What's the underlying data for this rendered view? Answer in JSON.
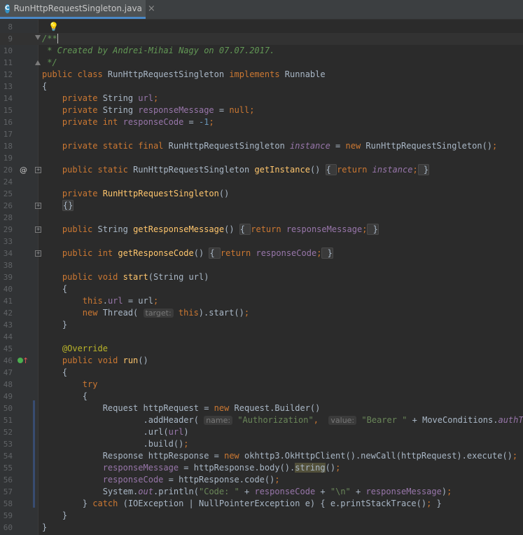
{
  "tab": {
    "icon_letter": "C",
    "title": "RunHttpRequestSingleton.java",
    "close": "×"
  },
  "lines": [
    {
      "num": "8",
      "parts": []
    },
    {
      "num": "9",
      "parts": [
        [
          "cm",
          "/**"
        ]
      ]
    },
    {
      "num": "10",
      "parts": [
        [
          "cm",
          " * Created by Andrei-Mihai Nagy on 07.07.2017."
        ]
      ]
    },
    {
      "num": "11",
      "parts": [
        [
          "cm",
          " */"
        ]
      ]
    },
    {
      "num": "12",
      "parts": [
        [
          "kw",
          "public class "
        ],
        [
          "",
          "RunHttpRequestSingleton "
        ],
        [
          "kw",
          "implements "
        ],
        [
          "",
          "Runnable"
        ]
      ]
    },
    {
      "num": "13",
      "parts": [
        [
          "",
          "{"
        ]
      ]
    },
    {
      "num": "14",
      "parts": [
        [
          "",
          "    "
        ],
        [
          "kw",
          "private "
        ],
        [
          "",
          "String "
        ],
        [
          "fld",
          "url"
        ],
        [
          "kw",
          ";"
        ]
      ]
    },
    {
      "num": "15",
      "parts": [
        [
          "",
          "    "
        ],
        [
          "kw",
          "private "
        ],
        [
          "",
          "String "
        ],
        [
          "fld",
          "responseMessage"
        ],
        [
          "",
          " = "
        ],
        [
          "kw",
          "null;"
        ]
      ]
    },
    {
      "num": "16",
      "parts": [
        [
          "",
          "    "
        ],
        [
          "kw",
          "private int "
        ],
        [
          "fld",
          "responseCode"
        ],
        [
          "",
          " = "
        ],
        [
          "num",
          "-1"
        ],
        [
          "kw",
          ";"
        ]
      ]
    },
    {
      "num": "17",
      "parts": []
    },
    {
      "num": "18",
      "parts": [
        [
          "",
          "    "
        ],
        [
          "kw",
          "private static final "
        ],
        [
          "",
          "RunHttpRequestSingleton "
        ],
        [
          "sfld",
          "instance"
        ],
        [
          "",
          " = "
        ],
        [
          "kw",
          "new "
        ],
        [
          "",
          "RunHttpRequestSingleton()"
        ],
        [
          "kw",
          ";"
        ]
      ]
    },
    {
      "num": "19",
      "parts": []
    },
    {
      "num": "20",
      "parts": [
        [
          "",
          "    "
        ],
        [
          "kw",
          "public static "
        ],
        [
          "",
          "RunHttpRequestSingleton "
        ],
        [
          "mth",
          "getInstance"
        ],
        [
          "",
          "() "
        ],
        [
          "folded",
          "{ "
        ],
        [
          "kw",
          "return "
        ],
        [
          "sfld",
          "instance"
        ],
        [
          "kw",
          ";"
        ],
        [
          "folded",
          " }"
        ]
      ]
    },
    {
      "num": "24",
      "parts": []
    },
    {
      "num": "25",
      "parts": [
        [
          "",
          "    "
        ],
        [
          "kw",
          "private "
        ],
        [
          "mth",
          "RunHttpRequestSingleton"
        ],
        [
          "",
          "()"
        ]
      ]
    },
    {
      "num": "26",
      "parts": [
        [
          "",
          "    "
        ],
        [
          "folded",
          "{}"
        ]
      ]
    },
    {
      "num": "28",
      "parts": []
    },
    {
      "num": "29",
      "parts": [
        [
          "",
          "    "
        ],
        [
          "kw",
          "public "
        ],
        [
          "",
          "String "
        ],
        [
          "mth",
          "getResponseMessage"
        ],
        [
          "",
          "() "
        ],
        [
          "folded",
          "{ "
        ],
        [
          "kw",
          "return "
        ],
        [
          "fld",
          "responseMessage"
        ],
        [
          "kw",
          ";"
        ],
        [
          "folded",
          " }"
        ]
      ]
    },
    {
      "num": "33",
      "parts": []
    },
    {
      "num": "34",
      "parts": [
        [
          "",
          "    "
        ],
        [
          "kw",
          "public int "
        ],
        [
          "mth",
          "getResponseCode"
        ],
        [
          "",
          "() "
        ],
        [
          "folded",
          "{ "
        ],
        [
          "kw",
          "return "
        ],
        [
          "fld",
          "responseCode"
        ],
        [
          "kw",
          ";"
        ],
        [
          "folded",
          " }"
        ]
      ]
    },
    {
      "num": "38",
      "parts": []
    },
    {
      "num": "39",
      "parts": [
        [
          "",
          "    "
        ],
        [
          "kw",
          "public void "
        ],
        [
          "mth",
          "start"
        ],
        [
          "",
          "(String url)"
        ]
      ]
    },
    {
      "num": "40",
      "parts": [
        [
          "",
          "    {"
        ]
      ]
    },
    {
      "num": "41",
      "parts": [
        [
          "",
          "        "
        ],
        [
          "kw",
          "this"
        ],
        [
          "",
          "."
        ],
        [
          "fld",
          "url"
        ],
        [
          "",
          " = url"
        ],
        [
          "kw",
          ";"
        ]
      ]
    },
    {
      "num": "42",
      "parts": [
        [
          "",
          "        "
        ],
        [
          "kw",
          "new "
        ],
        [
          "",
          "Thread( "
        ],
        [
          "hint",
          "target:"
        ],
        [
          " ",
          " "
        ],
        [
          "kw",
          "this"
        ],
        [
          "",
          ").start()"
        ],
        [
          "kw",
          ";"
        ]
      ]
    },
    {
      "num": "43",
      "parts": [
        [
          "",
          "    }"
        ]
      ]
    },
    {
      "num": "44",
      "parts": []
    },
    {
      "num": "45",
      "parts": [
        [
          "",
          "    "
        ],
        [
          "ann",
          "@Override"
        ]
      ]
    },
    {
      "num": "46",
      "parts": [
        [
          "",
          "    "
        ],
        [
          "kw",
          "public void "
        ],
        [
          "mth",
          "run"
        ],
        [
          "",
          "()"
        ]
      ]
    },
    {
      "num": "47",
      "parts": [
        [
          "",
          "    {"
        ]
      ]
    },
    {
      "num": "48",
      "parts": [
        [
          "",
          "        "
        ],
        [
          "kw",
          "try"
        ]
      ]
    },
    {
      "num": "49",
      "parts": [
        [
          "",
          "        {"
        ]
      ]
    },
    {
      "num": "50",
      "parts": [
        [
          "",
          "            Request httpRequest = "
        ],
        [
          "kw",
          "new "
        ],
        [
          "",
          "Request.Builder()"
        ]
      ]
    },
    {
      "num": "51",
      "parts": [
        [
          "",
          "                    .addHeader( "
        ],
        [
          "hint",
          "name:"
        ],
        [
          "",
          " "
        ],
        [
          "str",
          "\"Authorization\""
        ],
        [
          "kw",
          ", "
        ],
        [
          "",
          " "
        ],
        [
          "hint",
          "value:"
        ],
        [
          "",
          " "
        ],
        [
          "str",
          "\"Bearer \""
        ],
        [
          "",
          " + MoveConditions."
        ],
        [
          "sfld",
          "authToken"
        ],
        [
          "",
          ")"
        ]
      ]
    },
    {
      "num": "52",
      "parts": [
        [
          "",
          "                    .url("
        ],
        [
          "fld",
          "url"
        ],
        [
          "",
          ")"
        ]
      ]
    },
    {
      "num": "53",
      "parts": [
        [
          "",
          "                    .build()"
        ],
        [
          "kw",
          ";"
        ]
      ]
    },
    {
      "num": "54",
      "parts": [
        [
          "",
          "            Response httpResponse = "
        ],
        [
          "kw",
          "new "
        ],
        [
          "",
          "okhttp3.OkHttpClient().newCall(httpRequest).execute()"
        ],
        [
          "kw",
          ";"
        ]
      ]
    },
    {
      "num": "55",
      "parts": [
        [
          "",
          "            "
        ],
        [
          "fld",
          "responseMessage"
        ],
        [
          "",
          " = httpResponse.body()."
        ],
        [
          "hl",
          "string"
        ],
        [
          "",
          "()"
        ],
        [
          "kw",
          ";"
        ]
      ]
    },
    {
      "num": "56",
      "parts": [
        [
          "",
          "            "
        ],
        [
          "fld",
          "responseCode"
        ],
        [
          "",
          " = httpResponse.code()"
        ],
        [
          "kw",
          ";"
        ]
      ]
    },
    {
      "num": "57",
      "parts": [
        [
          "",
          "            System."
        ],
        [
          "sfld",
          "out"
        ],
        [
          "",
          ".println("
        ],
        [
          "str",
          "\"Code: \""
        ],
        [
          "",
          " + "
        ],
        [
          "fld",
          "responseCode"
        ],
        [
          "",
          " + "
        ],
        [
          "str",
          "\"\\n\""
        ],
        [
          "",
          " + "
        ],
        [
          "fld",
          "responseMessage"
        ],
        [
          "",
          ")"
        ],
        [
          "kw",
          ";"
        ]
      ]
    },
    {
      "num": "58",
      "parts": [
        [
          "",
          "        } "
        ],
        [
          "kw",
          "catch "
        ],
        [
          "",
          "(IOException | NullPointerException e) { e.printStackTrace()"
        ],
        [
          "kw",
          "; "
        ],
        [
          "",
          "}"
        ]
      ]
    },
    {
      "num": "59",
      "parts": [
        [
          "",
          "    }"
        ]
      ]
    },
    {
      "num": "60",
      "parts": [
        [
          "",
          "}"
        ]
      ]
    }
  ],
  "gutter_icons": {
    "line20": "@",
    "line46": "↑"
  }
}
